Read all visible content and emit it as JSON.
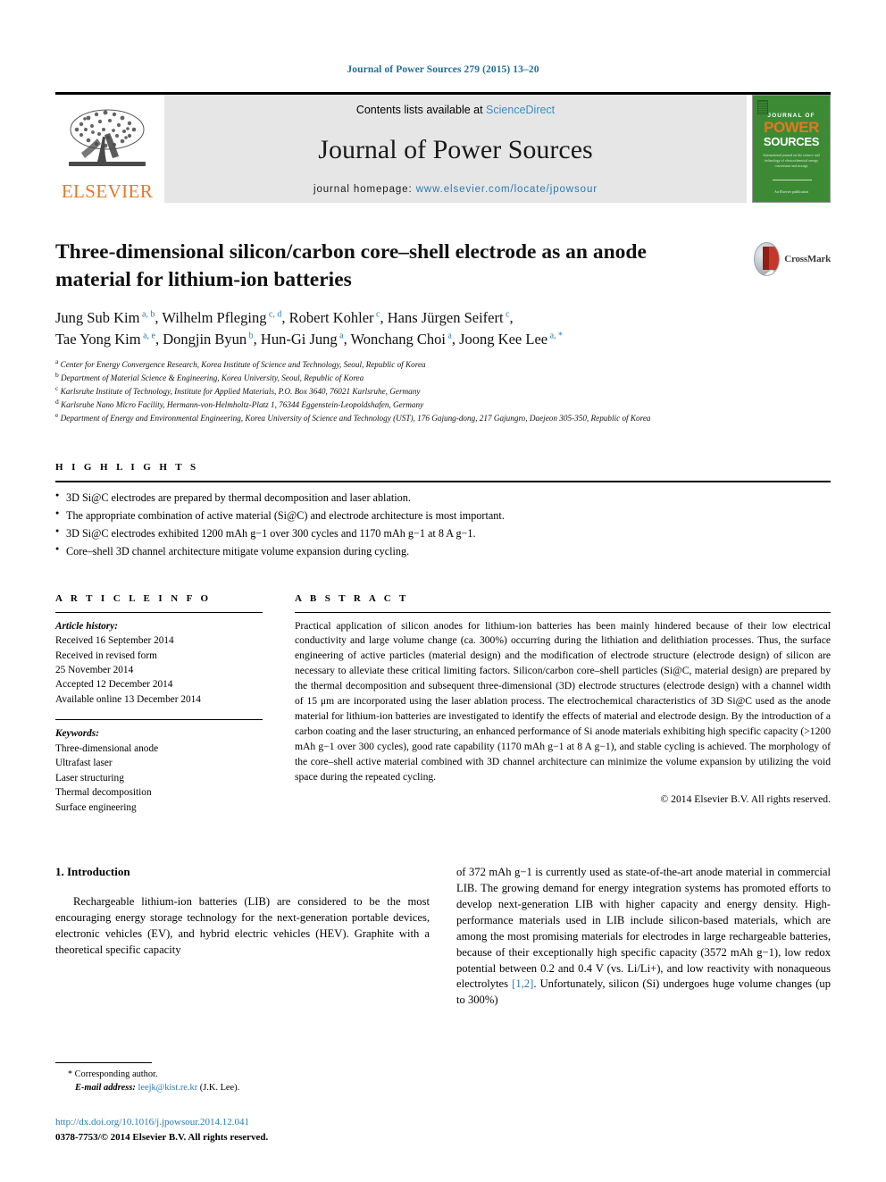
{
  "running_head": "Journal of Power Sources 279 (2015) 13–20",
  "masthead": {
    "contents_prefix": "Contents lists available at ",
    "sciencedirect": "ScienceDirect",
    "journal_title": "Journal of Power Sources",
    "homepage_prefix": "journal homepage: ",
    "homepage_url": "www.elsevier.com/locate/jpowsour",
    "elsevier_wordmark": "ELSEVIER",
    "cover": {
      "line1": "JOURNAL OF",
      "line2": "POWER",
      "line3": "SOURCES",
      "blurb": "International journal on the science and technology of electrochemical energy conversion and storage",
      "foot": "An Elsevier publication"
    },
    "colors": {
      "elsevier_orange": "#e87722",
      "link_blue": "#2a7ab0",
      "cover_green": "#3c8b34"
    }
  },
  "crossmark": {
    "label": "CrossMark"
  },
  "article": {
    "title": "Three-dimensional silicon/carbon core–shell electrode as an anode material for lithium-ion batteries",
    "authors_line1": "Jung Sub Kim ^a, b^, Wilhelm Pfleging ^c, d^, Robert Kohler ^c^, Hans Jürgen Seifert ^c^,",
    "authors_line2": "Tae Yong Kim ^a, e^, Dongjin Byun ^b^, Hun-Gi Jung ^a^, Wonchang Choi ^a^, Joong Kee Lee ^a, *^",
    "authors": [
      {
        "name": "Jung Sub Kim",
        "marks": "a, b"
      },
      {
        "name": "Wilhelm Pfleging",
        "marks": "c, d"
      },
      {
        "name": "Robert Kohler",
        "marks": "c"
      },
      {
        "name": "Hans Jürgen Seifert",
        "marks": "c"
      },
      {
        "name": "Tae Yong Kim",
        "marks": "a, e"
      },
      {
        "name": "Dongjin Byun",
        "marks": "b"
      },
      {
        "name": "Hun-Gi Jung",
        "marks": "a"
      },
      {
        "name": "Wonchang Choi",
        "marks": "a"
      },
      {
        "name": "Joong Kee Lee",
        "marks": "a, *"
      }
    ],
    "affiliations": [
      {
        "mark": "a",
        "text": "Center for Energy Convergence Research, Korea Institute of Science and Technology, Seoul, Republic of Korea"
      },
      {
        "mark": "b",
        "text": "Department of Material Science & Engineering, Korea University, Seoul, Republic of Korea"
      },
      {
        "mark": "c",
        "text": "Karlsruhe Institute of Technology, Institute for Applied Materials, P.O. Box 3640, 76021 Karlsruhe, Germany"
      },
      {
        "mark": "d",
        "text": "Karlsruhe Nano Micro Facility, Hermann-von-Helmholtz-Platz 1, 76344 Eggenstein-Leopoldshafen, Germany"
      },
      {
        "mark": "e",
        "text": "Department of Energy and Environmental Engineering, Korea University of Science and Technology (UST), 176 Gajung-dong, 217 Gajungro, Daejeon 305-350, Republic of Korea"
      }
    ]
  },
  "highlights": {
    "heading": "H I G H L I G H T S",
    "items": [
      "3D Si@C electrodes are prepared by thermal decomposition and laser ablation.",
      "The appropriate combination of active material (Si@C) and electrode architecture is most important.",
      "3D Si@C electrodes exhibited 1200 mAh g−1 over 300 cycles and 1170 mAh g−1 at 8 A g−1.",
      "Core–shell 3D channel architecture mitigate volume expansion during cycling."
    ]
  },
  "article_info": {
    "heading": "A R T I C L E   I N F O",
    "history_label": "Article history:",
    "history": [
      "Received 16 September 2014",
      "Received in revised form",
      "25 November 2014",
      "Accepted 12 December 2014",
      "Available online 13 December 2014"
    ],
    "keywords_label": "Keywords:",
    "keywords": [
      "Three-dimensional anode",
      "Ultrafast laser",
      "Laser structuring",
      "Thermal decomposition",
      "Surface engineering"
    ]
  },
  "abstract": {
    "heading": "A B S T R A C T",
    "text": "Practical application of silicon anodes for lithium-ion batteries has been mainly hindered because of their low electrical conductivity and large volume change (ca. 300%) occurring during the lithiation and delithiation processes. Thus, the surface engineering of active particles (material design) and the modification of electrode structure (electrode design) of silicon are necessary to alleviate these critical limiting factors. Silicon/carbon core–shell particles (Si@C, material design) are prepared by the thermal decomposition and subsequent three-dimensional (3D) electrode structures (electrode design) with a channel width of 15 μm are incorporated using the laser ablation process. The electrochemical characteristics of 3D Si@C used as the anode material for lithium-ion batteries are investigated to identify the effects of material and electrode design. By the introduction of a carbon coating and the laser structuring, an enhanced performance of Si anode materials exhibiting high specific capacity (>1200 mAh g−1 over 300 cycles), good rate capability (1170 mAh g−1 at 8 A g−1), and stable cycling is achieved. The morphology of the core–shell active material combined with 3D channel architecture can minimize the volume expansion by utilizing the void space during the repeated cycling.",
    "copyright": "© 2014 Elsevier B.V. All rights reserved."
  },
  "introduction": {
    "heading": "1. Introduction",
    "left_paragraph": "Rechargeable lithium-ion batteries (LIB) are considered to be the most encouraging energy storage technology for the next-generation portable devices, electronic vehicles (EV), and hybrid electric vehicles (HEV). Graphite with a theoretical specific capacity",
    "right_paragraph_part1": "of 372 mAh g−1 is currently used as state-of-the-art anode material in commercial LIB. The growing demand for energy integration systems has promoted efforts to develop next-generation LIB with higher capacity and energy density. High-performance materials used in LIB include silicon-based materials, which are among the most promising materials for electrodes in large rechargeable batteries, because of their exceptionally high specific capacity (3572 mAh g−1), low redox potential between 0.2 and 0.4 V (vs. Li/Li+), and low reactivity with nonaqueous electrolytes ",
    "right_citation": "[1,2]",
    "right_paragraph_part2": ". Unfortunately, silicon (Si) undergoes huge volume changes (up to 300%)"
  },
  "footer": {
    "corresponding_marker": "*",
    "corresponding_label": "Corresponding author.",
    "email_label": "E-mail address:",
    "email": "leejk@kist.re.kr",
    "email_suffix": "(J.K. Lee).",
    "doi": "http://dx.doi.org/10.1016/j.jpowsour.2014.12.041",
    "issn_line": "0378-7753/© 2014 Elsevier B.V. All rights reserved."
  }
}
